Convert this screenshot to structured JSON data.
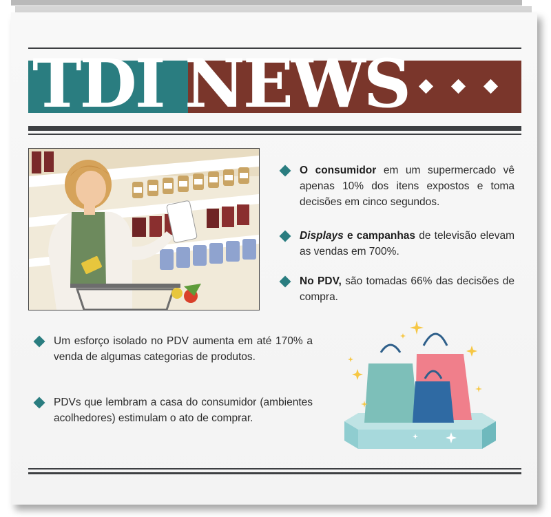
{
  "masthead": {
    "title": "TDI NEWS"
  },
  "colors": {
    "teal": "#2a7d80",
    "brick": "#7a362b",
    "paper": "#f6f6f6",
    "rule": "#3d3f42"
  },
  "illustration": {
    "subject": "woman-shopping-supermarket",
    "bags": "shopping-bags-on-pedestal"
  },
  "bullets_right": [
    {
      "bold": "O consumidor",
      "text": " em um supermercado vê apenas 10% dos itens expostos e toma decisões em cinco segundos."
    },
    {
      "bold_italic": "Displays",
      "bold": " e campanhas",
      "text": " de televisão elevam as vendas em 700%."
    },
    {
      "bold": "No PDV,",
      "text": " são tomadas 66% das decisões de compra."
    }
  ],
  "bullets_left": [
    {
      "text": "Um esforço isolado no PDV aumenta em até 170% a venda de algumas categorias de produtos."
    },
    {
      "text": "PDVs que lembram a casa do consumidor (ambientes acolhedores) estimulam o ato de comprar."
    }
  ]
}
